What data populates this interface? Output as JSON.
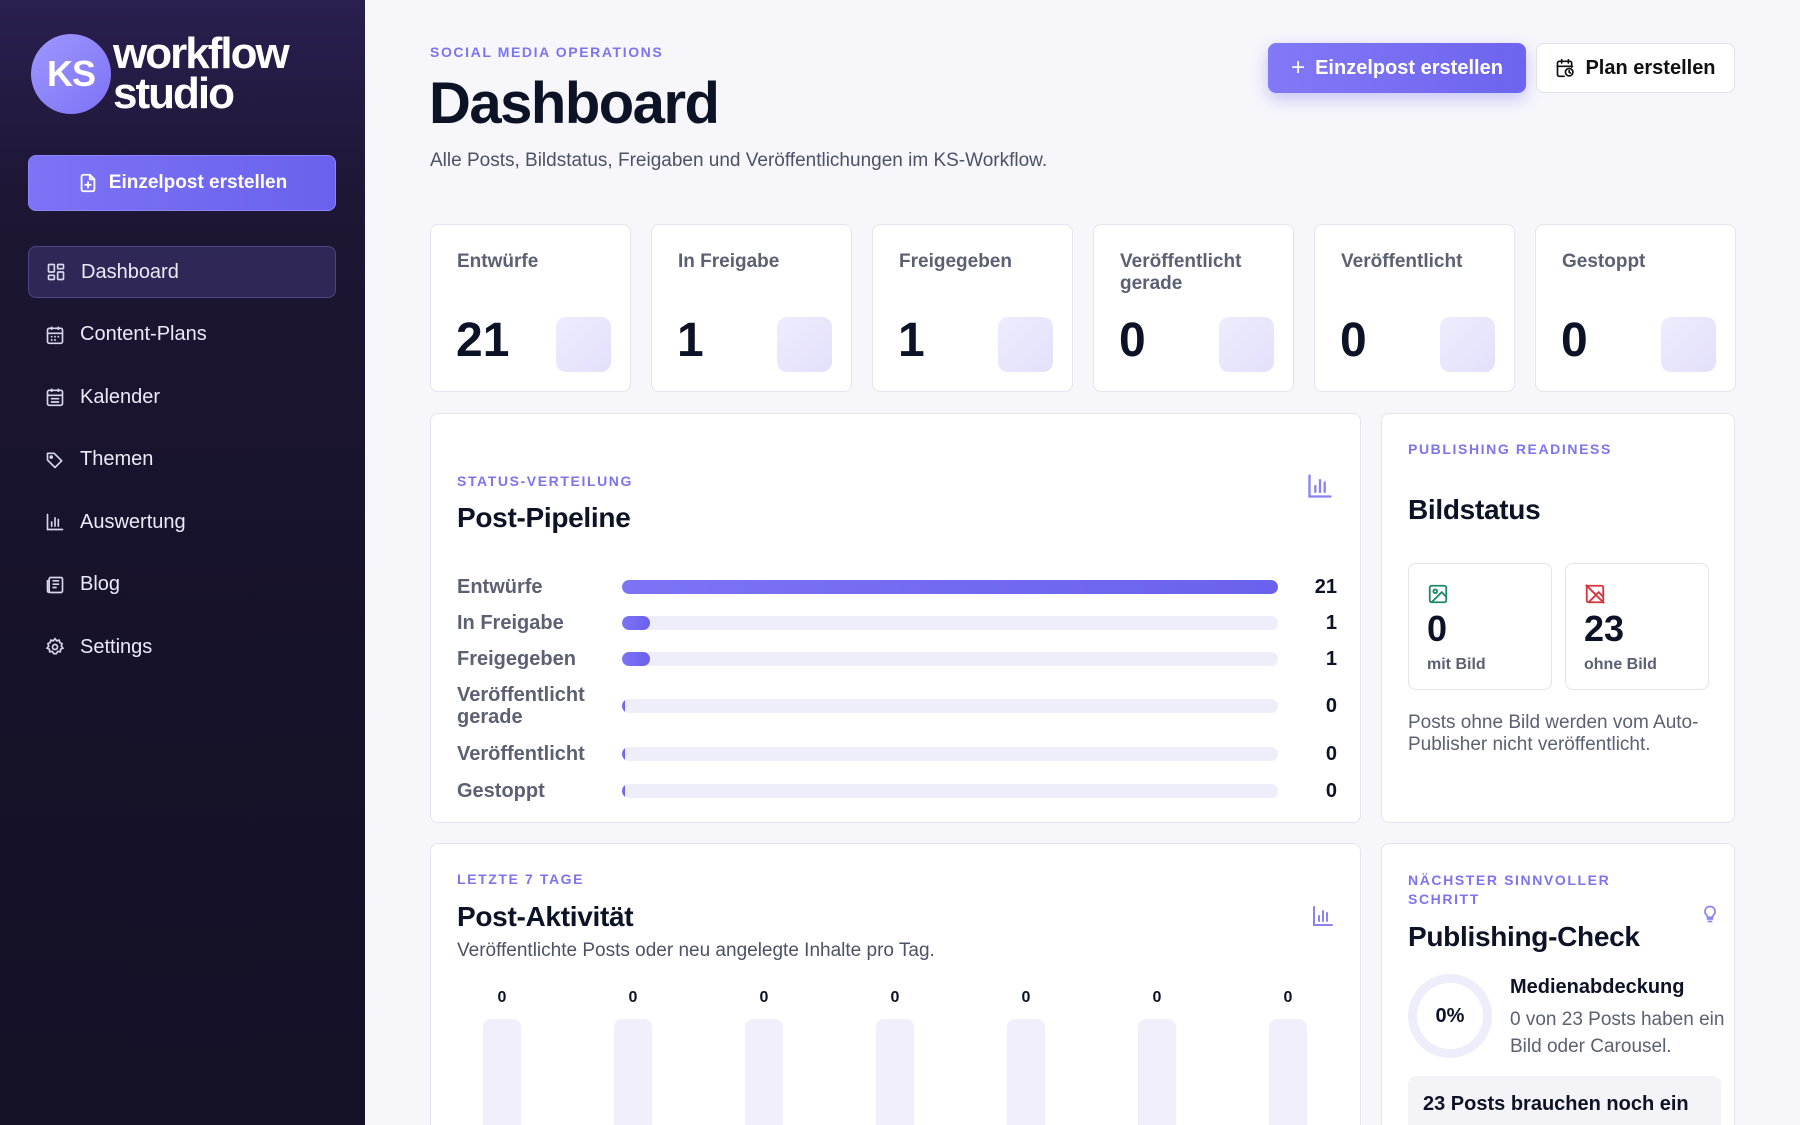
{
  "brand": {
    "initials": "KS",
    "line1": "workflow",
    "line2": "studio"
  },
  "sidebar": {
    "cta_label": "Einzelpost erstellen",
    "items": [
      {
        "label": "Dashboard",
        "icon": "dashboard-icon",
        "active": true
      },
      {
        "label": "Content-Plans",
        "icon": "calendar-icon"
      },
      {
        "label": "Kalender",
        "icon": "calendar-icon"
      },
      {
        "label": "Themen",
        "icon": "tag-icon"
      },
      {
        "label": "Auswertung",
        "icon": "bar-chart-icon"
      },
      {
        "label": "Blog",
        "icon": "newspaper-icon"
      },
      {
        "label": "Settings",
        "icon": "gear-icon"
      }
    ]
  },
  "header": {
    "eyebrow": "SOCIAL MEDIA OPERATIONS",
    "title": "Dashboard",
    "subtitle": "Alle Posts, Bildstatus, Freigaben und Veröffentlichungen im KS-Workflow.",
    "primary_button": "Einzelpost erstellen",
    "secondary_button": "Plan erstellen"
  },
  "stats": [
    {
      "label": "Entwürfe",
      "value": "21"
    },
    {
      "label": "In Freigabe",
      "value": "1"
    },
    {
      "label": "Freigegeben",
      "value": "1"
    },
    {
      "label": "Veröffentlicht gerade",
      "value": "0"
    },
    {
      "label": "Veröffentlicht",
      "value": "0"
    },
    {
      "label": "Gestoppt",
      "value": "0"
    }
  ],
  "pipeline": {
    "eyebrow": "STATUS-VERTEILUNG",
    "title": "Post-Pipeline",
    "rows": [
      {
        "label": "Entwürfe",
        "count": 21
      },
      {
        "label": "In Freigabe",
        "count": 1
      },
      {
        "label": "Freigegeben",
        "count": 1
      },
      {
        "label": "Veröffentlicht gerade",
        "count": 0
      },
      {
        "label": "Veröffentlicht",
        "count": 0
      },
      {
        "label": "Gestoppt",
        "count": 0
      }
    ]
  },
  "bildstatus": {
    "eyebrow": "PUBLISHING READINESS",
    "title": "Bildstatus",
    "with_image": {
      "value": "0",
      "label": "mit Bild"
    },
    "without_image": {
      "value": "23",
      "label": "ohne Bild"
    },
    "note": "Posts ohne Bild werden vom Auto-Publisher nicht veröffentlicht."
  },
  "activity": {
    "eyebrow": "LETZTE 7 TAGE",
    "title": "Post-Aktivität",
    "subtitle": "Veröffentlichte Posts oder neu angelegte Inhalte pro Tag.",
    "values": [
      0,
      0,
      0,
      0,
      0,
      0,
      0
    ]
  },
  "check": {
    "eyebrow": "NÄCHSTER SINNVOLLER SCHRITT",
    "title": "Publishing-Check",
    "ring_value": "0%",
    "media_title": "Medienabdeckung",
    "media_text": "0 von 23 Posts haben ein Bild oder Carousel.",
    "warning": "23 Posts brauchen noch ein"
  },
  "colors": {
    "accent": "#7269f2",
    "sidebar": "#161229",
    "background": "#f6f6fb"
  }
}
